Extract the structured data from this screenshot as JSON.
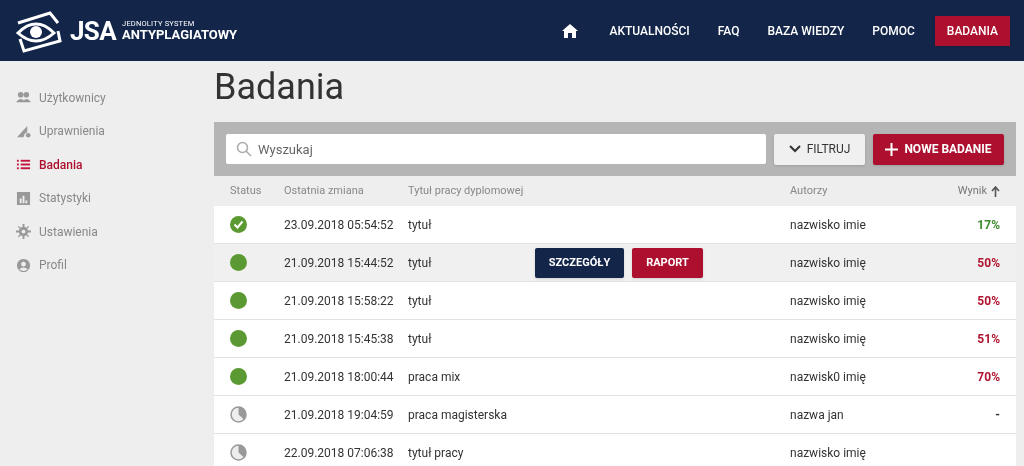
{
  "logo": {
    "short": "JSA",
    "line_1": "JEDNOLITY SYSTEM",
    "line_2": "ANTYPLAGIATOWY"
  },
  "nav": [
    {
      "kind": "home",
      "selected": false
    },
    {
      "kind": "link",
      "label": "AKTUALNOŚCI",
      "selected": false
    },
    {
      "kind": "link",
      "label": "FAQ",
      "selected": false
    },
    {
      "kind": "link",
      "label": "BAZA WIEDZY",
      "selected": false
    },
    {
      "kind": "link",
      "label": "POMOC",
      "selected": false
    },
    {
      "kind": "link",
      "label": "BADANIA",
      "selected": true
    }
  ],
  "sidebar": {
    "items": [
      {
        "kind": "users",
        "label": "Użytkownicy",
        "selected": false
      },
      {
        "kind": "permissions",
        "label": "Uprawnienia",
        "selected": false
      },
      {
        "kind": "list",
        "label": "Badania",
        "selected": true
      },
      {
        "kind": "stats",
        "label": "Statystyki",
        "selected": false
      },
      {
        "kind": "settings",
        "label": "Ustawienia",
        "selected": false
      },
      {
        "kind": "profile",
        "label": "Profil",
        "selected": false
      }
    ]
  },
  "page_title": "Badania",
  "search": {
    "placeholder": "Wyszukaj"
  },
  "filter_button": "FILTRUJ",
  "new_button": "NOWE BADANIE",
  "table": {
    "columns": [
      {
        "label": "Status",
        "sorted": false
      },
      {
        "label": "Ostatnia zmiana",
        "sorted": false
      },
      {
        "label": "Tytuł pracy dyplomowej",
        "sorted": false
      },
      {
        "label": "Autorzy",
        "sorted": false
      },
      {
        "label": "Wynik",
        "sorted": true
      }
    ],
    "rows": [
      {
        "kind": "done",
        "date": "23.09.2018 05:54:52",
        "title": "tytuł",
        "authors": "nazwisko imie",
        "result": "17%",
        "color": "#3c8a2e",
        "hovered": false
      },
      {
        "kind": "ok",
        "date": "21.09.2018 15:44:52",
        "title": "tytuł",
        "authors": "nazwisko imię",
        "result": "50%",
        "color": "#b0132f",
        "hovered": true,
        "actions": [
          "SZCZEGÓŁY",
          "RAPORT"
        ]
      },
      {
        "kind": "ok",
        "date": "21.09.2018 15:58:22",
        "title": "tytuł",
        "authors": "nazwisko imię",
        "result": "50%",
        "color": "#b0132f",
        "hovered": false
      },
      {
        "kind": "ok",
        "date": "21.09.2018 15:45:38",
        "title": "tytuł",
        "authors": "nazwisko imię",
        "result": "51%",
        "color": "#b0132f",
        "hovered": false
      },
      {
        "kind": "ok",
        "date": "21.09.2018 18:00:44",
        "title": "praca mix",
        "authors": "nazwisk0 imię",
        "result": "70%",
        "color": "#b0132f",
        "hovered": false
      },
      {
        "kind": "pending",
        "date": "21.09.2018 19:04:59",
        "title": "praca magisterska",
        "authors": "nazwa jan",
        "result": "-",
        "hovered": false
      },
      {
        "kind": "pending",
        "date": "22.09.2018 07:06:38",
        "title": "tytuł pracy",
        "authors": "nazwisko imię",
        "hovered": false
      }
    ]
  }
}
